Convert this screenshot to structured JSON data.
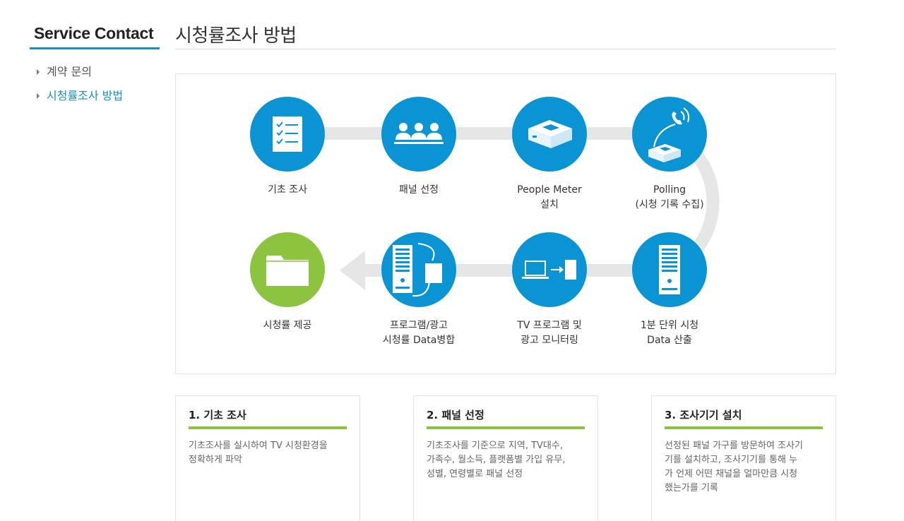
{
  "sidebar": {
    "title": "Service Contact",
    "items": [
      {
        "label": "계약 문의",
        "active": false
      },
      {
        "label": "시청률조사 방법",
        "active": true
      }
    ]
  },
  "page": {
    "title": "시청률조사 방법"
  },
  "process": {
    "steps": [
      {
        "icon": "checklist-icon",
        "label": [
          "기초 조사"
        ]
      },
      {
        "icon": "people-icon",
        "label": [
          "패널 선정"
        ]
      },
      {
        "icon": "meter-device-icon",
        "label": [
          "People Meter",
          "설치"
        ]
      },
      {
        "icon": "phone-polling-icon",
        "label": [
          "Polling",
          "(시청 기록 수집)"
        ]
      },
      {
        "icon": "server-icon",
        "label": [
          "1분 단위 시청",
          "Data 산출"
        ]
      },
      {
        "icon": "laptop-transfer-icon",
        "label": [
          "TV 프로그램 및",
          "광고 모니터링"
        ]
      },
      {
        "icon": "server-merge-icon",
        "label": [
          "프로그램/광고",
          "시청률 Data병합"
        ]
      },
      {
        "icon": "folder-icon",
        "label": [
          "시청률 제공"
        ]
      }
    ],
    "colors": {
      "blue": "#0b94d4",
      "green": "#8cc43f",
      "track": "#e6e6e6"
    }
  },
  "cards": [
    {
      "title": "1. 기초 조사",
      "lines": [
        "기초조사를 실시하여 TV 시청환경을",
        "정확하게 파악"
      ]
    },
    {
      "title": "2. 패널 선정",
      "lines": [
        "기초조사를 기준으로 지역, TV대수,",
        "가족수, 월소득, 플랫폼별 가입 유무,",
        "성별, 연령별로 패널 선정"
      ]
    },
    {
      "title": "3. 조사기기 설치",
      "lines": [
        "선정된 패널 가구를 방문하여 조사기",
        "기를 설치하고, 조사기기를 통해 누",
        "가 언제 어떤 채널을 얼마만큼 시청",
        "했는가를 기록"
      ]
    }
  ]
}
